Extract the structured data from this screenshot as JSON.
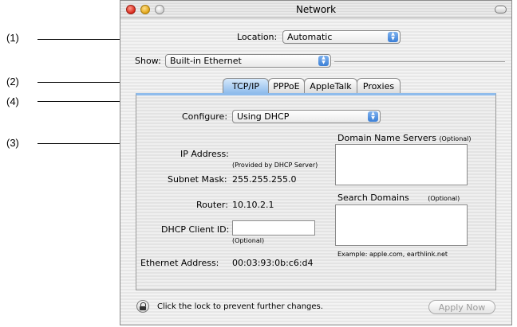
{
  "callouts": [
    "(1)",
    "(2)",
    "(4)",
    "(3)"
  ],
  "window": {
    "title": "Network",
    "location_label": "Location:",
    "location_value": "Automatic",
    "show_label": "Show:",
    "show_value": "Built-in Ethernet"
  },
  "tabs": [
    "TCP/IP",
    "PPPoE",
    "AppleTalk",
    "Proxies"
  ],
  "panel": {
    "configure_label": "Configure:",
    "configure_value": "Using DHCP",
    "dns_label": "Domain Name Servers",
    "dns_optional": "(Optional)",
    "ip_label": "IP Address:",
    "ip_note": "(Provided by DHCP Server)",
    "subnet_label": "Subnet Mask:",
    "subnet_value": "255.255.255.0",
    "router_label": "Router:",
    "router_value": "10.10.2.1",
    "search_label": "Search Domains",
    "search_optional": "(Optional)",
    "dhcp_label": "DHCP Client ID:",
    "dhcp_value": "",
    "dhcp_optional": "(Optional)",
    "example": "Example: apple.com, earthlink.net",
    "ethernet_label": "Ethernet Address:",
    "ethernet_value": "00:03:93:0b:c6:d4"
  },
  "footer": {
    "lock_text": "Click the lock to prevent further changes.",
    "apply_label": "Apply Now"
  },
  "colors": {
    "tab_active": "#8fbcec",
    "popup_arrows": "#3b7fd6"
  },
  "icons": [
    "lock-icon",
    "popup-arrows-icon"
  ]
}
